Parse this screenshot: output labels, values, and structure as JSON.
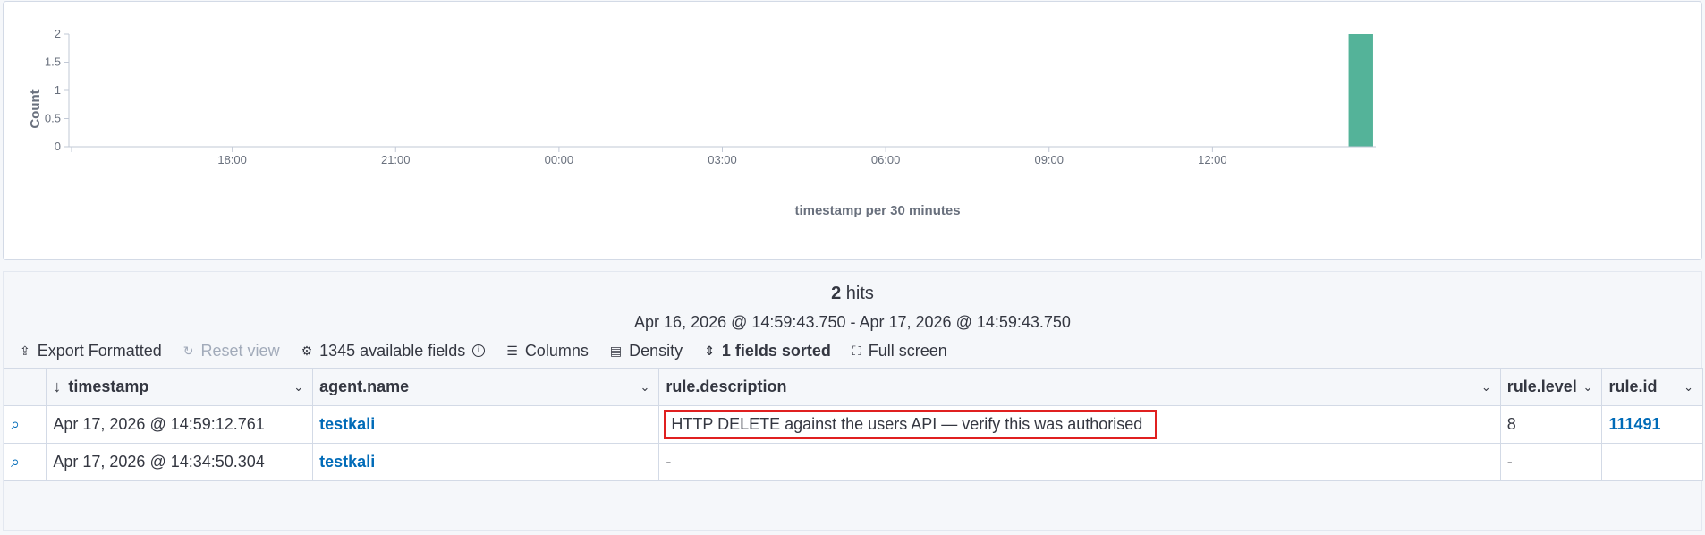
{
  "chart_data": {
    "type": "bar",
    "ylabel": "Count",
    "xlabel": "timestamp per 30 minutes",
    "yticks": [
      "0",
      "0.5",
      "1",
      "1.5",
      "2"
    ],
    "ylim": [
      0,
      2
    ],
    "xticks": [
      "18:00",
      "21:00",
      "00:00",
      "03:00",
      "06:00",
      "09:00",
      "12:00"
    ],
    "x_range_hours": [
      15,
      39
    ],
    "bars": [
      {
        "x_start_hour": 38.5,
        "x_end_hour": 38.95,
        "value": 2
      }
    ],
    "bar_color": "#54b399"
  },
  "hits": {
    "count": "2",
    "label": "hits",
    "range": "Apr 16, 2026 @ 14:59:43.750 - Apr 17, 2026 @ 14:59:43.750"
  },
  "toolbar": {
    "export": "Export Formatted",
    "reset": "Reset view",
    "fields": "1345 available fields",
    "columns": "Columns",
    "density": "Density",
    "sorted": "1 fields sorted",
    "fullscreen": "Full screen"
  },
  "table": {
    "columns": [
      "timestamp",
      "agent.name",
      "rule.description",
      "rule.level",
      "rule.id"
    ],
    "rows": [
      {
        "timestamp": "Apr 17, 2026 @ 14:59:12.761",
        "agent": "testkali",
        "description": "HTTP DELETE against the users API — verify this was authorised",
        "level": "8",
        "id": "111491"
      },
      {
        "timestamp": "Apr 17, 2026 @ 14:34:50.304",
        "agent": "testkali",
        "description": "-",
        "level": "-",
        "id": ""
      }
    ]
  }
}
